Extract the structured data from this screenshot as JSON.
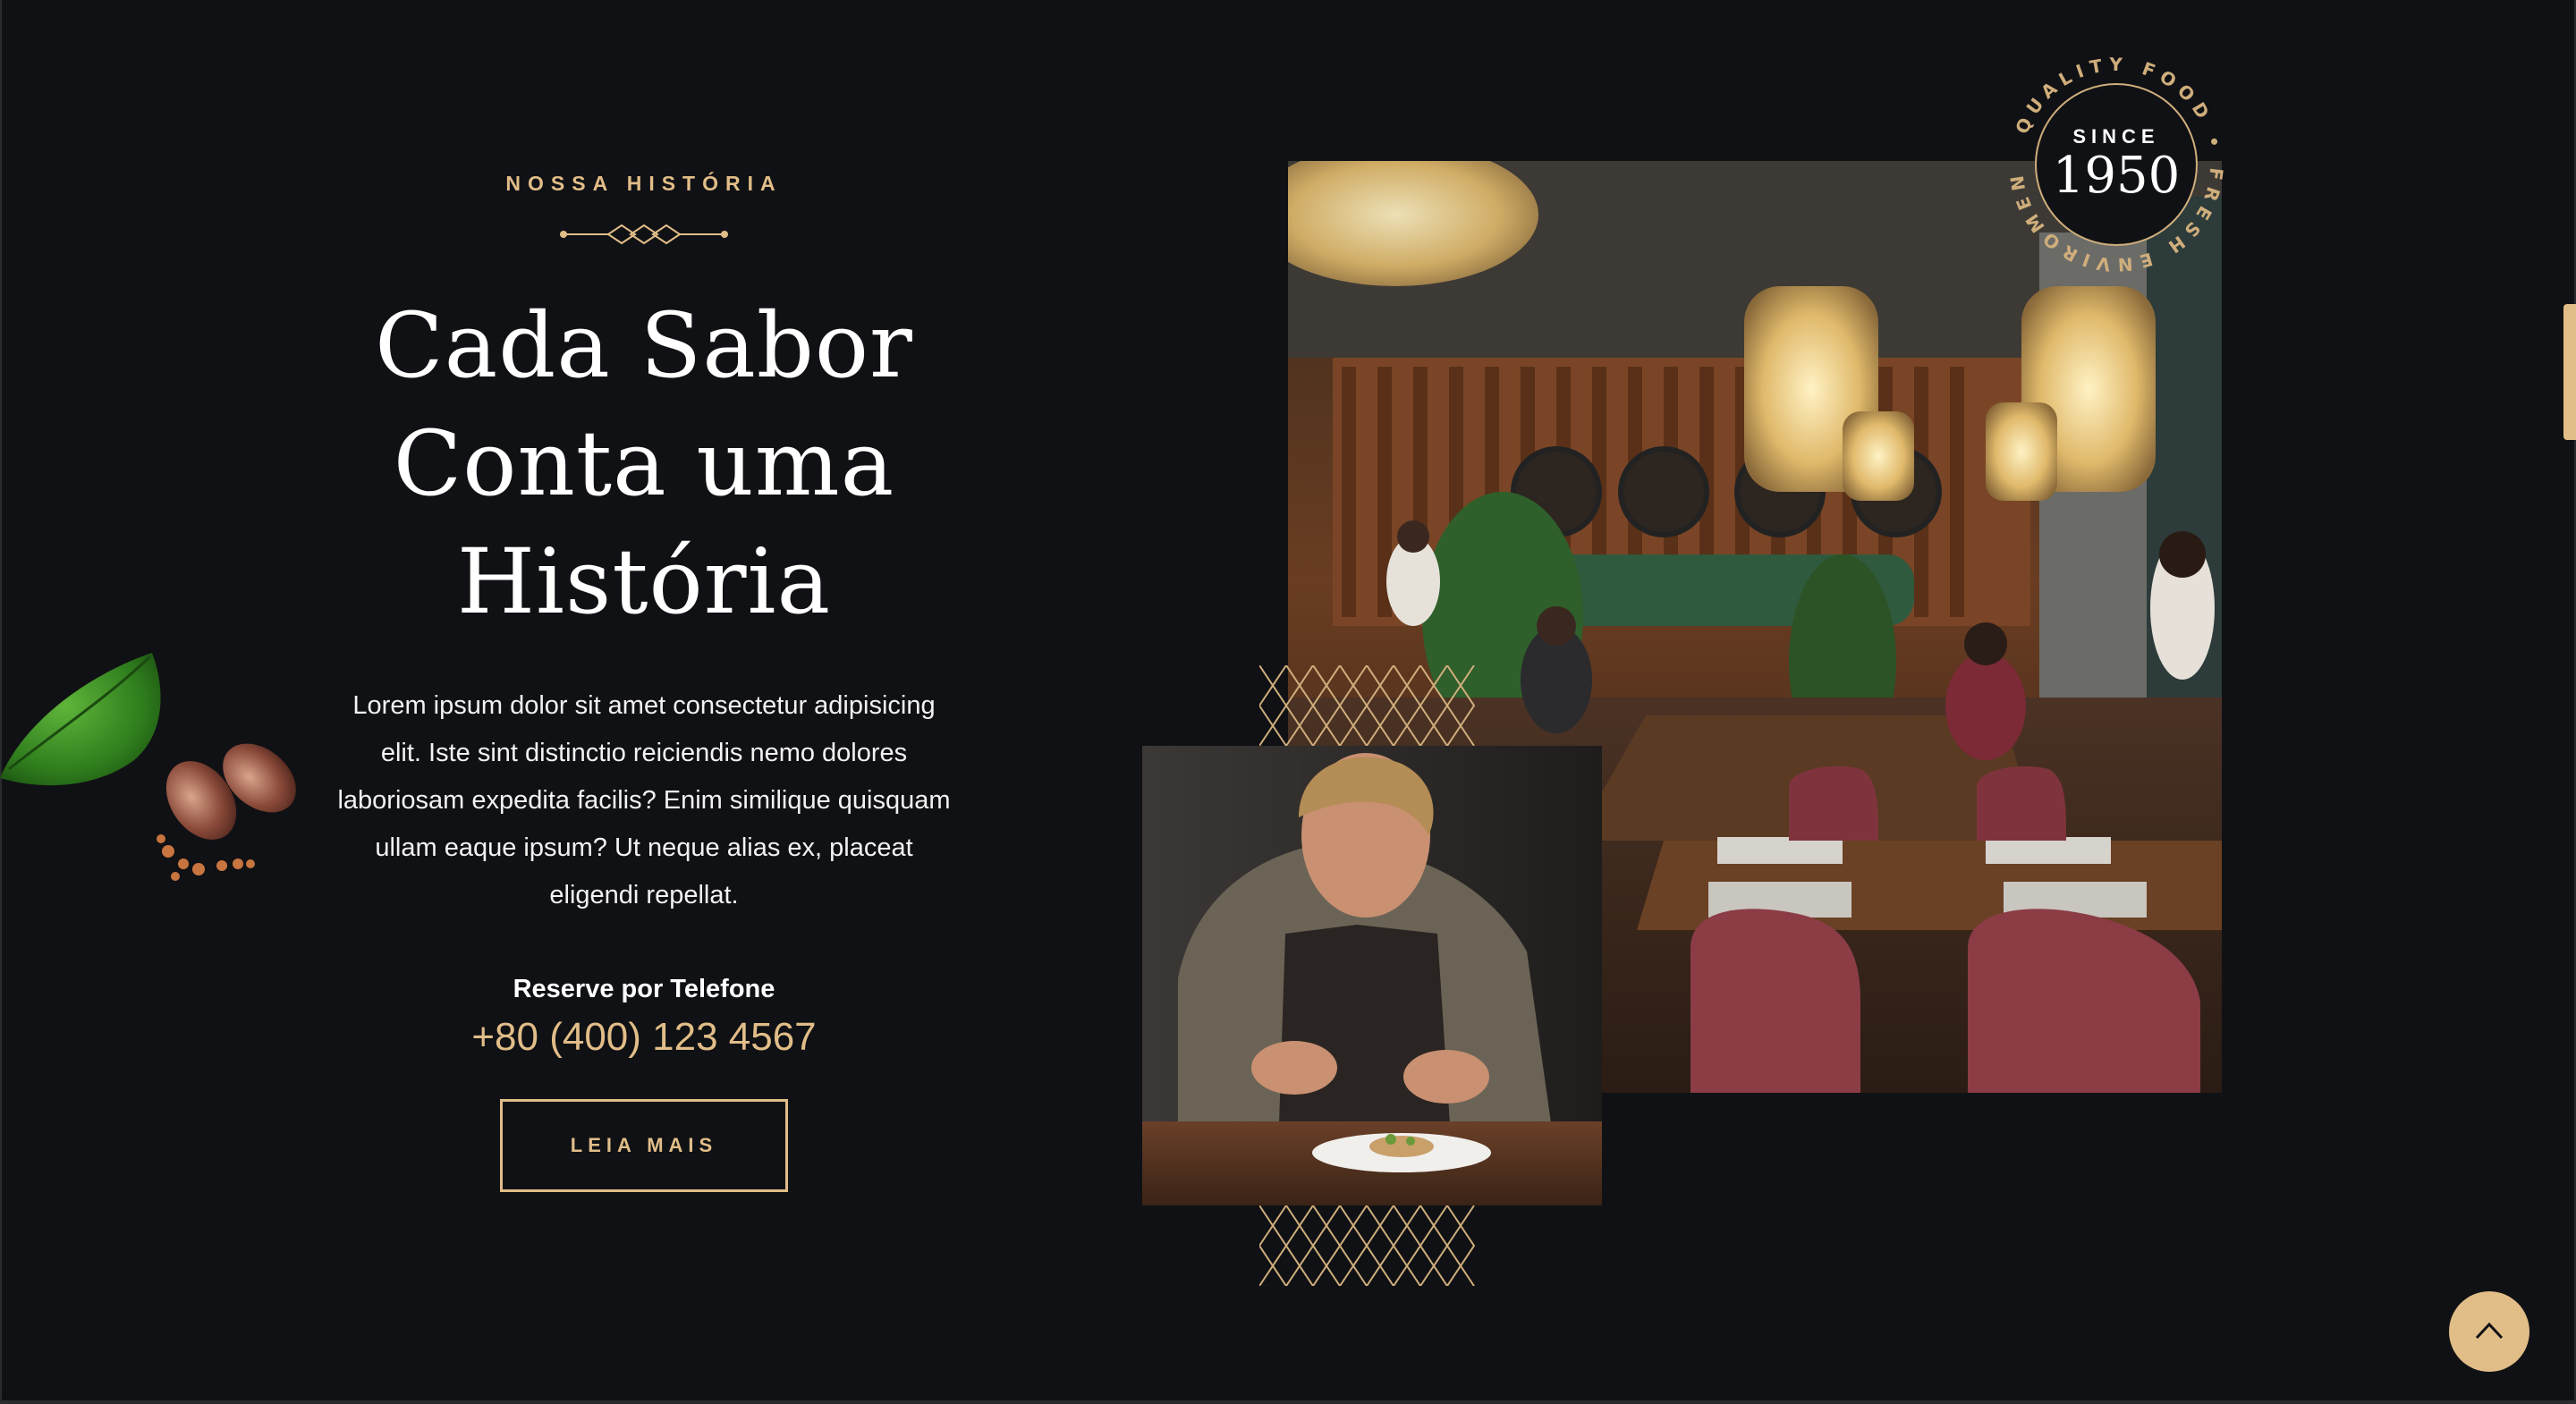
{
  "section": {
    "eyebrow": "NOSSA HISTÓRIA",
    "headline_line1": "Cada Sabor",
    "headline_line2": "Conta uma",
    "headline_line3": "História",
    "body": "Lorem ipsum dolor sit amet consectetur adipisicing elit. Iste sint distinctio reiciendis nemo dolores laboriosam expedita facilis? Enim similique quisquam ullam eaque ipsum? Ut neque alias ex, placeat eligendi repellat.",
    "phone_label": "Reserve por Telefone",
    "phone_number": "+80 (400) 123 4567",
    "cta_label": "LEIA MAIS"
  },
  "badge": {
    "since_label": "SINCE",
    "year": "1950",
    "ring_text": "QUALITY FOOD • FRESH ENVIROMENT •"
  },
  "icons": {
    "back_to_top": "chevron-up-icon",
    "ornament": "diamond-divider-icon"
  },
  "colors": {
    "background": "#101114",
    "accent": "#e1bd88",
    "text": "#ffffff"
  }
}
